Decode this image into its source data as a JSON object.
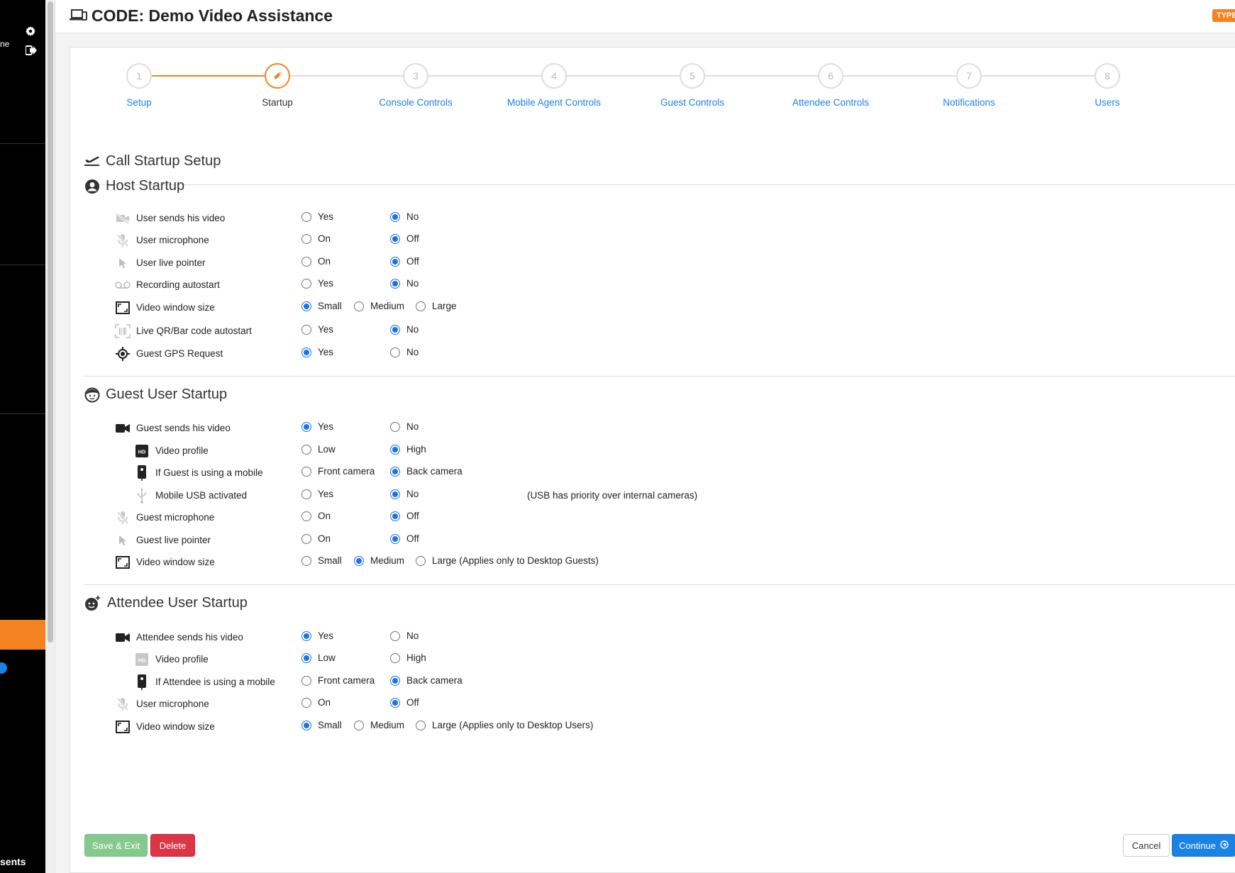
{
  "colors": {
    "accent": "#f58220",
    "link": "#1a82e2",
    "radio": "#1a73e8",
    "sidebar": "#000000"
  },
  "sidebar": {
    "name_fragment": "ne",
    "bottom_text": "sents",
    "settings_icon": "gear-icon",
    "logout_icon": "sign-out-icon"
  },
  "header": {
    "title": "CODE: Demo Video Assistance",
    "badge": "TYPE"
  },
  "steps": [
    {
      "num": "1",
      "label": "Setup",
      "state": "done"
    },
    {
      "num": "",
      "label": "Startup",
      "state": "current"
    },
    {
      "num": "3",
      "label": "Console Controls",
      "state": "todo"
    },
    {
      "num": "4",
      "label": "Mobile Agent Controls",
      "state": "todo"
    },
    {
      "num": "5",
      "label": "Guest Controls",
      "state": "todo"
    },
    {
      "num": "6",
      "label": "Attendee Controls",
      "state": "todo"
    },
    {
      "num": "7",
      "label": "Notifications",
      "state": "todo"
    },
    {
      "num": "8",
      "label": "Users",
      "state": "todo"
    }
  ],
  "page_title": "Call Startup Setup",
  "sections": [
    {
      "title": "Host Startup",
      "icon": "user-circle-icon",
      "rows": [
        {
          "icon": "video-off-icon",
          "label": "User sends his video",
          "options": [
            "Yes",
            "No"
          ],
          "selected": 1
        },
        {
          "icon": "mic-off-icon",
          "label": "User microphone",
          "options": [
            "On",
            "Off"
          ],
          "selected": 1
        },
        {
          "icon": "pointer-icon",
          "label": "User live pointer",
          "options": [
            "On",
            "Off"
          ],
          "selected": 1
        },
        {
          "icon": "voicemail-icon",
          "label": "Recording autostart",
          "options": [
            "Yes",
            "No"
          ],
          "selected": 1
        },
        {
          "icon": "window-size-icon",
          "label": "Video window size",
          "options": [
            "Small",
            "Medium",
            "Large"
          ],
          "selected": 0
        },
        {
          "icon": "barcode-icon",
          "label": "Live QR/Bar code autostart",
          "options": [
            "Yes",
            "No"
          ],
          "selected": 1
        },
        {
          "icon": "gps-icon",
          "label": "Guest GPS Request",
          "options": [
            "Yes",
            "No"
          ],
          "selected": 0
        }
      ]
    },
    {
      "title": "Guest User Startup",
      "icon": "guest-face-icon",
      "rows": [
        {
          "icon": "video-camera-icon",
          "label": "Guest sends his video",
          "options": [
            "Yes",
            "No"
          ],
          "selected": 0
        },
        {
          "icon": "hd-icon",
          "label": "Video profile",
          "options": [
            "Low",
            "High"
          ],
          "selected": 1,
          "indent": true
        },
        {
          "icon": "mobile-icon",
          "label": "If Guest is using a mobile",
          "options": [
            "Front camera",
            "Back camera"
          ],
          "selected": 1,
          "indent": true
        },
        {
          "icon": "usb-icon",
          "label": "Mobile USB activated",
          "options": [
            "Yes",
            "No"
          ],
          "selected": 1,
          "indent": true,
          "note": "(USB has priority over internal cameras)"
        },
        {
          "icon": "mic-off-icon",
          "label": "Guest microphone",
          "options": [
            "On",
            "Off"
          ],
          "selected": 1
        },
        {
          "icon": "pointer-icon",
          "label": "Guest live pointer",
          "options": [
            "On",
            "Off"
          ],
          "selected": 1
        },
        {
          "icon": "window-size-icon",
          "label": "Video window size",
          "options": [
            "Small",
            "Medium",
            "Large (Applies only to Desktop Guests)"
          ],
          "selected": 1
        }
      ]
    },
    {
      "title": "Attendee User Startup",
      "icon": "attendee-face-icon",
      "rows": [
        {
          "icon": "video-camera-icon",
          "label": "Attendee sends his video",
          "options": [
            "Yes",
            "No"
          ],
          "selected": 0
        },
        {
          "icon": "hd-icon",
          "label": "Video profile",
          "options": [
            "Low",
            "High"
          ],
          "selected": 0,
          "indent": true
        },
        {
          "icon": "mobile-icon",
          "label": "If Attendee is using a mobile",
          "options": [
            "Front camera",
            "Back camera"
          ],
          "selected": 1,
          "indent": true
        },
        {
          "icon": "mic-off-icon",
          "label": "User microphone",
          "options": [
            "On",
            "Off"
          ],
          "selected": 1
        },
        {
          "icon": "window-size-icon",
          "label": "Video window size",
          "options": [
            "Small",
            "Medium",
            "Large (Applies only to Desktop Users)"
          ],
          "selected": 0
        }
      ]
    }
  ],
  "buttons": {
    "save_exit": "Save & Exit",
    "delete": "Delete",
    "cancel": "Cancel",
    "continue": "Continue"
  }
}
